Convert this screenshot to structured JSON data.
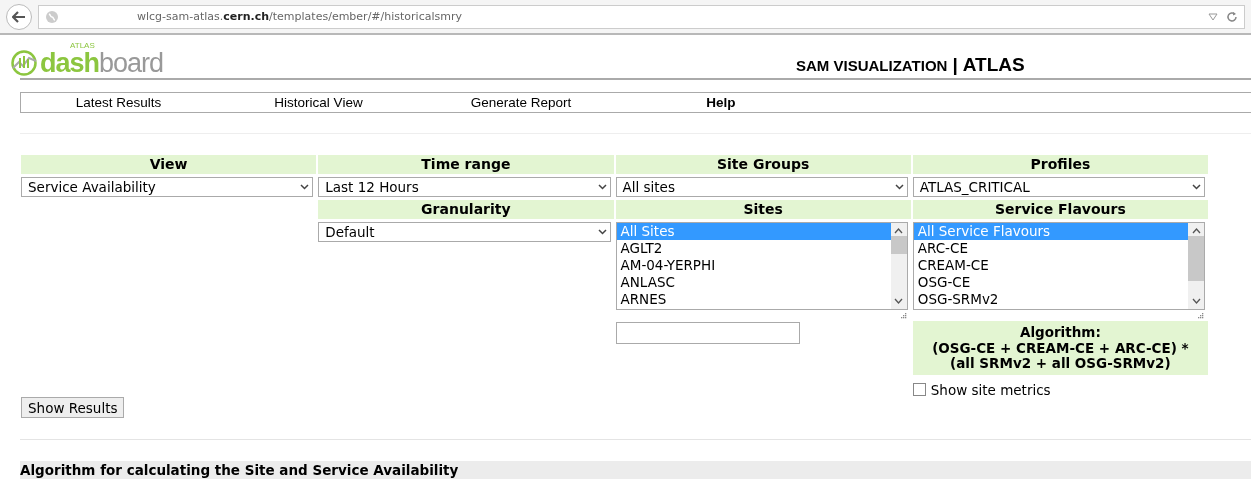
{
  "browser": {
    "url": "wlcg-sam-atlas.**cern.ch**/templates/ember/#/historicalsmry"
  },
  "header": {
    "logo_small": "ATLAS",
    "logo_word_1": "dash",
    "logo_word_2": "board",
    "title": "SAM VISUALIZATION",
    "separator": "|",
    "experiment": "ATLAS"
  },
  "nav": [
    {
      "label": "Latest Results",
      "bold": false
    },
    {
      "label": "Historical View",
      "bold": false
    },
    {
      "label": "Generate Report",
      "bold": false
    },
    {
      "label": "Help",
      "bold": true
    }
  ],
  "form": {
    "view": {
      "label": "View",
      "value": "Service Availability"
    },
    "time_range": {
      "label": "Time range",
      "value": "Last 12 Hours"
    },
    "site_groups": {
      "label": "Site Groups",
      "value": "All sites"
    },
    "profiles": {
      "label": "Profiles",
      "value": "ATLAS_CRITICAL"
    },
    "granularity": {
      "label": "Granularity",
      "value": "Default"
    },
    "sites": {
      "label": "Sites",
      "items": [
        {
          "label": "All Sites",
          "selected": true
        },
        {
          "label": "AGLT2",
          "selected": false
        },
        {
          "label": "AM-04-YERPHI",
          "selected": false
        },
        {
          "label": "ANLASC",
          "selected": false
        },
        {
          "label": "ARNES",
          "selected": false
        }
      ]
    },
    "service_flavours": {
      "label": "Service Flavours",
      "items": [
        {
          "label": "All Service Flavours",
          "selected": true
        },
        {
          "label": "ARC-CE",
          "selected": false
        },
        {
          "label": "CREAM-CE",
          "selected": false
        },
        {
          "label": "OSG-CE",
          "selected": false
        },
        {
          "label": "OSG-SRMv2",
          "selected": false
        }
      ]
    },
    "algorithm": [
      "Algorithm:",
      "(OSG-CE + CREAM-CE + ARC-CE) *",
      "(all SRMv2 + all OSG-SRMv2)"
    ],
    "show_site_metrics": {
      "label": "Show site metrics",
      "checked": false
    },
    "show_results": "Show Results"
  },
  "section_heading": "Algorithm for calculating the Site and Service Availability"
}
